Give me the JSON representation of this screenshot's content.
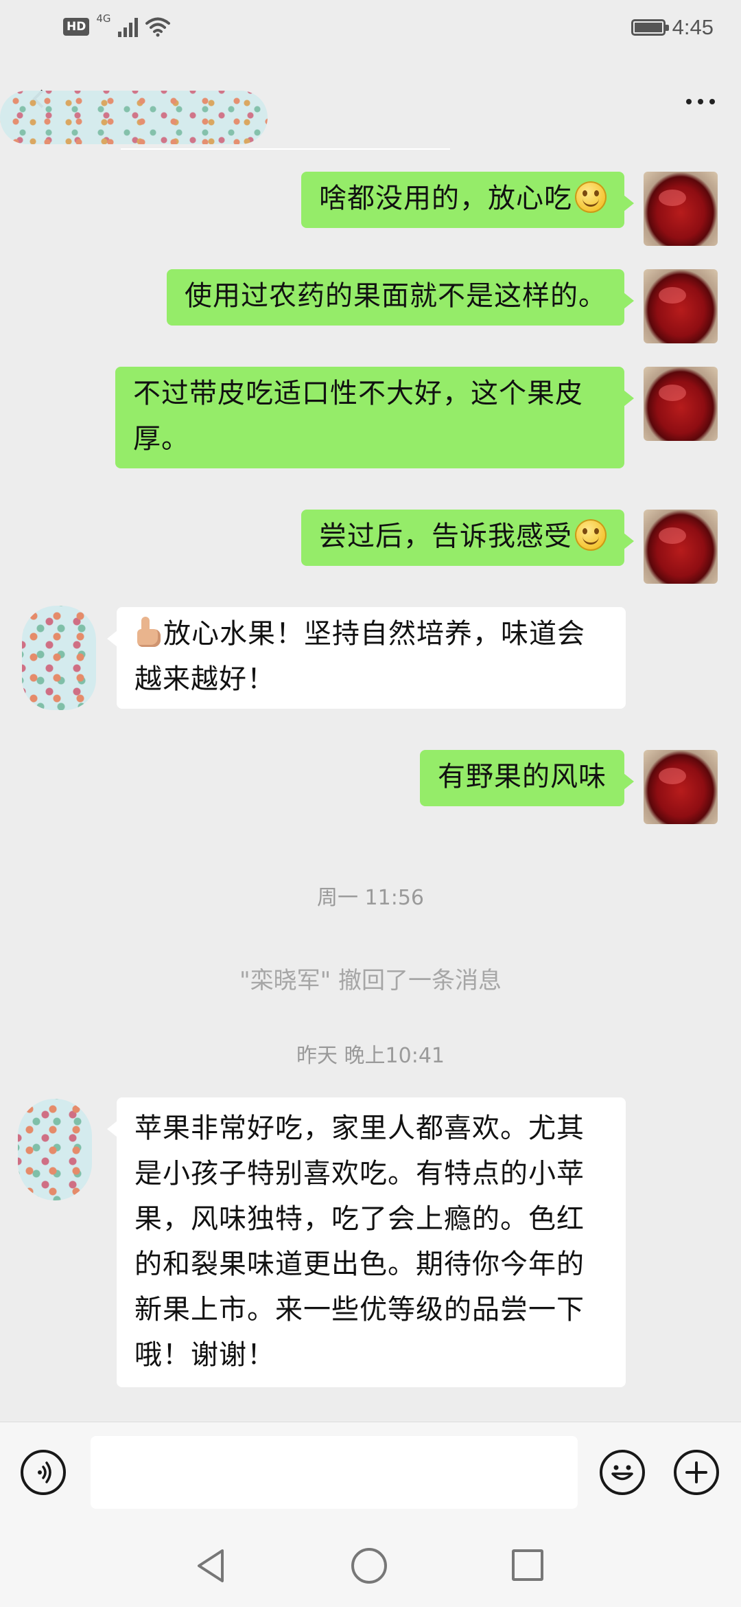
{
  "status_bar": {
    "network_badge": "HD",
    "network_type": "4G",
    "time": "4:45",
    "icons": [
      "signal-icon",
      "wifi-icon",
      "battery-icon"
    ]
  },
  "header": {
    "icons": [
      "back-icon",
      "more-icon"
    ]
  },
  "messages": [
    {
      "direction": "out",
      "text": "啥都没用的，放心吃",
      "emoji": "smile-emoji"
    },
    {
      "direction": "out",
      "text": "使用过农药的果面就不是这样的。"
    },
    {
      "direction": "out",
      "text": "不过带皮吃适口性不大好，这个果皮厚。"
    },
    {
      "direction": "out",
      "text": "尝过后，告诉我感受",
      "emoji": "smile-emoji"
    },
    {
      "direction": "in",
      "emoji": "thumbs-up-emoji",
      "text": "放心水果！坚持自然培养，味道会越来越好！"
    },
    {
      "direction": "out",
      "text": "有野果的风味"
    },
    {
      "type": "timestamp",
      "text": "周一 11:56"
    },
    {
      "type": "system",
      "text": "\"栾晓军\" 撤回了一条消息"
    },
    {
      "type": "timestamp",
      "text": "昨天 晚上10:41"
    },
    {
      "direction": "in",
      "text": "苹果非常好吃，家里人都喜欢。尤其是小孩子特别喜欢吃。有特点的小苹果，风味独特，吃了会上瘾的。色红的和裂果味道更出色。期待你今年的新果上市。来一些优等级的品尝一下哦！谢谢！"
    }
  ],
  "input_bar": {
    "text_value": "",
    "icons": [
      "voice-icon",
      "emoji-icon",
      "plus-icon"
    ]
  },
  "nav_bar": {
    "icons": [
      "nav-back-icon",
      "nav-home-icon",
      "nav-recent-icon"
    ]
  },
  "colors": {
    "background": "#ededed",
    "outgoing_bubble": "#95ec69",
    "incoming_bubble": "#ffffff",
    "system_text": "#9a9a9a"
  }
}
